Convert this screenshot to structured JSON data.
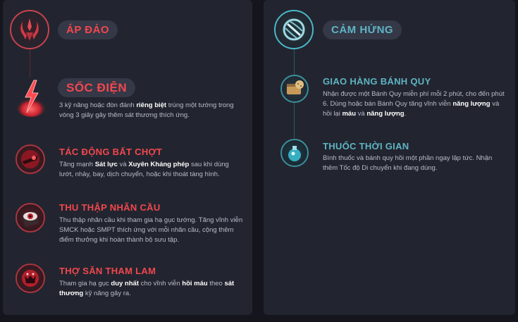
{
  "left_tree": {
    "title": "ÁP ĐẢO",
    "icon": "domination-icon",
    "accent": "#e8424a",
    "keystone": {
      "name": "SỐC ĐIỆN",
      "icon": "electrocute-icon",
      "desc": {
        "p1": "3 kỹ năng hoặc đòn đánh",
        "b1": "riêng biệt",
        "p2": "trúng một tướng trong vòng 3 giây gây thêm sát thương thích ứng."
      }
    },
    "runes": [
      {
        "name": "TÁC ĐỘNG BẤT CHỢT",
        "icon": "sudden-impact-icon",
        "desc": {
          "p1": "Tăng mạnh",
          "b1": "Sát lực",
          "p2": "và",
          "b2": "Xuyên Kháng phép",
          "p3": "sau khi dùng lướt, nhảy, bay, dịch chuyển, hoặc khi thoát tàng hình."
        }
      },
      {
        "name": "THU THẬP NHÃN CẦU",
        "icon": "eyeball-collection-icon",
        "desc": {
          "p1": "Thu thập nhãn cầu khi tham gia hạ gục tướng. Tăng vĩnh viễn SMCK hoặc SMPT thích ứng với mỗi nhãn cầu, cộng thêm điểm thưởng khi hoàn thành bộ sưu tập."
        }
      },
      {
        "name": "THỢ SĂN THAM LAM",
        "icon": "ravenous-hunter-icon",
        "desc": {
          "p1": "Tham gia hạ gục",
          "b1": "duy nhất",
          "p2": "cho vĩnh viễn",
          "b2": "hồi máu",
          "p3": "theo",
          "b3": "sát thương",
          "p4": "kỹ năng gây ra."
        }
      }
    ]
  },
  "right_tree": {
    "title": "CẢM HỨNG",
    "icon": "inspiration-icon",
    "accent": "#49b8c8",
    "runes": [
      {
        "name": "GIAO HÀNG BÁNH QUY",
        "icon": "biscuit-delivery-icon",
        "desc": {
          "p1": "Nhận được một Bánh Quy miễn phí mỗi 2 phút, cho đến phút 6. Dùng hoặc bán Bánh Quy tăng vĩnh viễn",
          "b1": "năng lượng",
          "p2": "và hồi lại",
          "b2": "máu",
          "p3": "và",
          "b3": "năng lượng",
          "p4": "."
        }
      },
      {
        "name": "THUỐC THỜI GIAN",
        "icon": "time-warp-tonic-icon",
        "desc": {
          "p1": "Bình thuốc và bánh quy hồi một phần ngay lập tức. Nhận thêm Tốc độ Di chuyển khi đang dùng."
        }
      }
    ]
  }
}
